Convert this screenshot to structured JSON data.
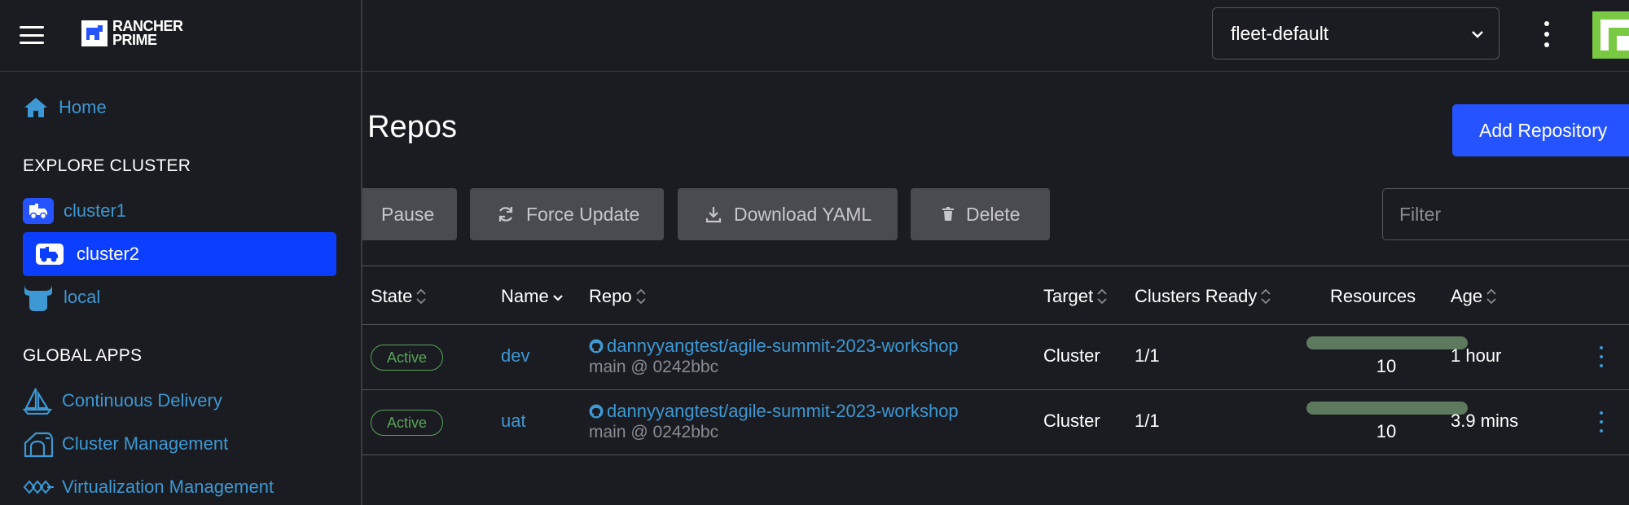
{
  "nav": {
    "home": "Home",
    "explore_cluster_heading": "EXPLORE CLUSTER",
    "clusters": [
      {
        "label": "cluster1",
        "icon": "cluster-icon"
      },
      {
        "label": "cluster2",
        "icon": "cluster-icon",
        "active": true
      },
      {
        "label": "local",
        "icon": "local-cluster-icon"
      }
    ],
    "global_apps_heading": "GLOBAL APPS",
    "apps": [
      {
        "label": "Continuous Delivery",
        "icon": "sailboat-icon"
      },
      {
        "label": "Cluster Management",
        "icon": "cluster-management-icon"
      },
      {
        "label": "Virtualization Management",
        "icon": "virtualization-icon"
      }
    ],
    "logo_text_line1": "RANCHER",
    "logo_text_line2": "PRIME"
  },
  "header": {
    "namespace": "fleet-default"
  },
  "page": {
    "title": ": Repos",
    "add_button": "Add Repository"
  },
  "actions": {
    "pause": "Pause",
    "force_update": "Force Update",
    "download_yaml": "Download YAML",
    "delete": "Delete",
    "filter_placeholder": "Filter"
  },
  "table": {
    "columns": [
      "State",
      "Name",
      "Repo",
      "Target",
      "Clusters Ready",
      "Resources",
      "Age"
    ],
    "rows": [
      {
        "state": "Active",
        "name": "dev",
        "repo": "dannyyangtest/agile-summit-2023-workshop",
        "branch": "main @ 0242bbc",
        "target": "Cluster",
        "clusters_ready": "1/1",
        "resources": "10",
        "age": "1 hour"
      },
      {
        "state": "Active",
        "name": "uat",
        "repo": "dannyyangtest/agile-summit-2023-workshop",
        "branch": "main @ 0242bbc",
        "target": "Cluster",
        "clusters_ready": "1/1",
        "resources": "10",
        "age": "3.9 mins"
      }
    ]
  },
  "colors": {
    "accent": "#2453ff",
    "active_nav": "#0b3eff",
    "link": "#3d98d3",
    "state_active": "#5aa35a",
    "background": "#1b1c21"
  }
}
